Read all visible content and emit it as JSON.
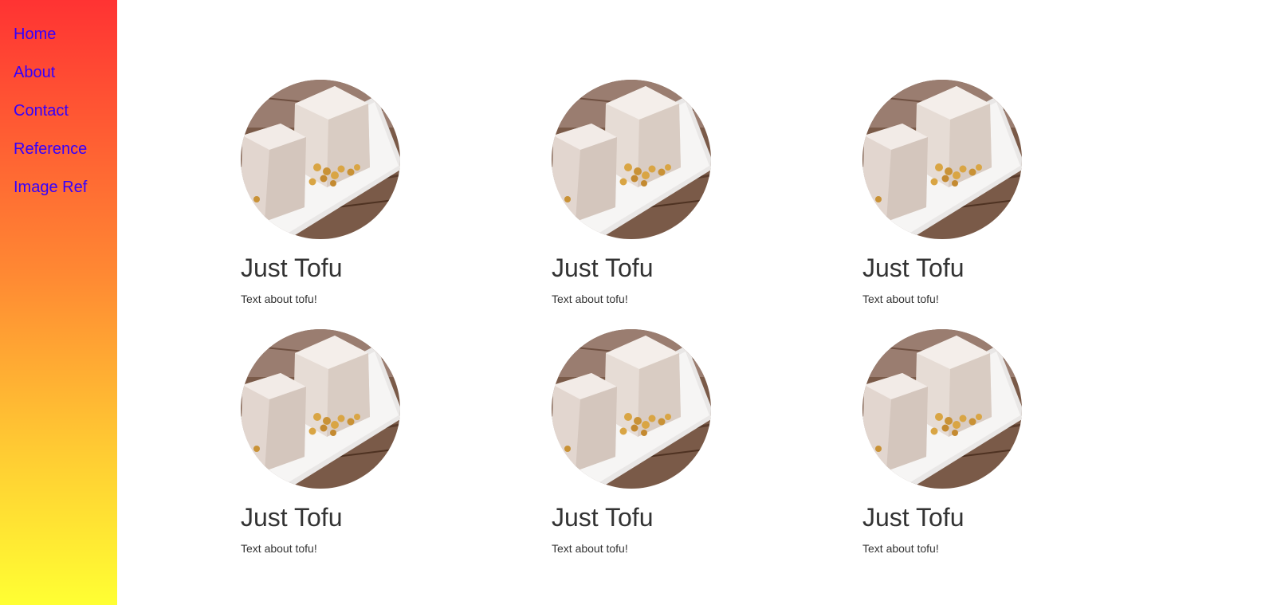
{
  "sidebar": {
    "items": [
      {
        "label": "Home"
      },
      {
        "label": "About"
      },
      {
        "label": "Contact"
      },
      {
        "label": "Reference"
      },
      {
        "label": "Image Ref"
      }
    ]
  },
  "colors": {
    "link": "#3300ff",
    "gradient_top": "#ff3333",
    "gradient_bottom": "#ffff33",
    "text": "#333333"
  },
  "cards": [
    {
      "title": "Just Tofu",
      "text": "Text about tofu!",
      "image": "tofu-image"
    },
    {
      "title": "Just Tofu",
      "text": "Text about tofu!",
      "image": "tofu-image"
    },
    {
      "title": "Just Tofu",
      "text": "Text about tofu!",
      "image": "tofu-image"
    },
    {
      "title": "Just Tofu",
      "text": "Text about tofu!",
      "image": "tofu-image"
    },
    {
      "title": "Just Tofu",
      "text": "Text about tofu!",
      "image": "tofu-image"
    },
    {
      "title": "Just Tofu",
      "text": "Text about tofu!",
      "image": "tofu-image"
    }
  ]
}
